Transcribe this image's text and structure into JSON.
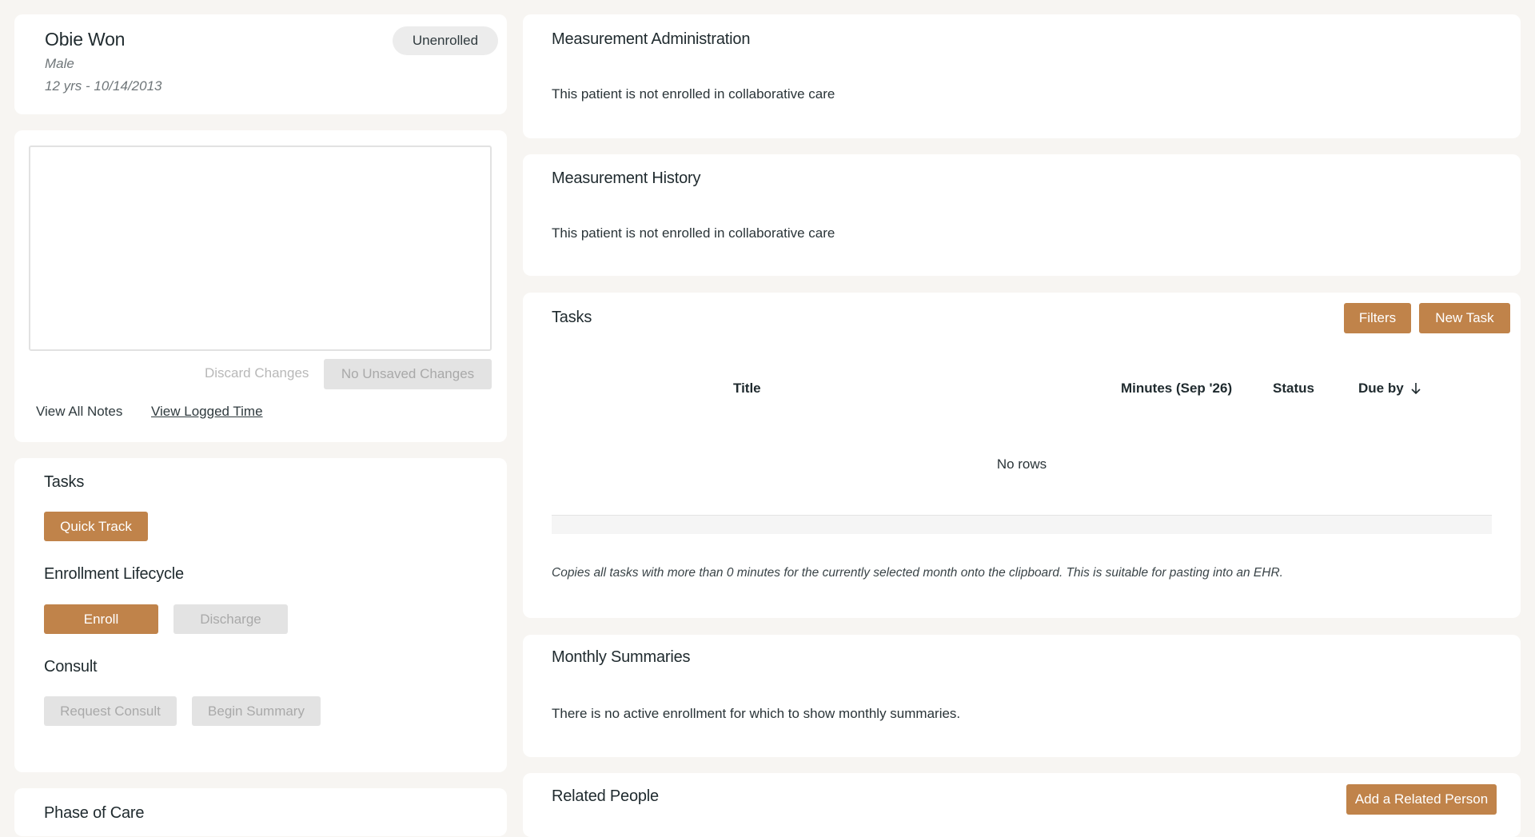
{
  "patient": {
    "name": "Obie Won",
    "gender": "Male",
    "age_dob": "12 yrs - 10/14/2013",
    "status_badge": "Unenrolled"
  },
  "notes": {
    "textarea_value": "",
    "discard_label": "Discard Changes",
    "save_label": "No Unsaved Changes",
    "view_all_label": "View All Notes",
    "view_logged_label": "View Logged Time"
  },
  "actions": {
    "tasks_title": "Tasks",
    "quick_track_label": "Quick Track",
    "enrollment_title": "Enrollment Lifecycle",
    "enroll_label": "Enroll",
    "discharge_label": "Discharge",
    "consult_title": "Consult",
    "request_consult_label": "Request Consult",
    "begin_summary_label": "Begin Summary"
  },
  "phase_of_care": {
    "title": "Phase of Care"
  },
  "measurement_admin": {
    "title": "Measurement Administration",
    "message": "This patient is not enrolled in collaborative care"
  },
  "measurement_history": {
    "title": "Measurement History",
    "message": "This patient is not enrolled in collaborative care"
  },
  "tasks_panel": {
    "title": "Tasks",
    "filters_label": "Filters",
    "new_task_label": "New Task",
    "columns": {
      "title": "Title",
      "minutes": "Minutes (Sep '26)",
      "status": "Status",
      "due_by": "Due by"
    },
    "empty_message": "No rows",
    "footnote": "Copies all tasks with more than 0 minutes for the currently selected month onto the clipboard. This is suitable for pasting into an EHR."
  },
  "monthly_summaries": {
    "title": "Monthly Summaries",
    "message": "There is no active enrollment for which to show monthly summaries."
  },
  "related_people": {
    "title": "Related People",
    "add_label": "Add a Related Person"
  },
  "colors": {
    "accent": "#c0834a",
    "background": "#f7f5f2",
    "disabled": "#e3e3e3"
  }
}
